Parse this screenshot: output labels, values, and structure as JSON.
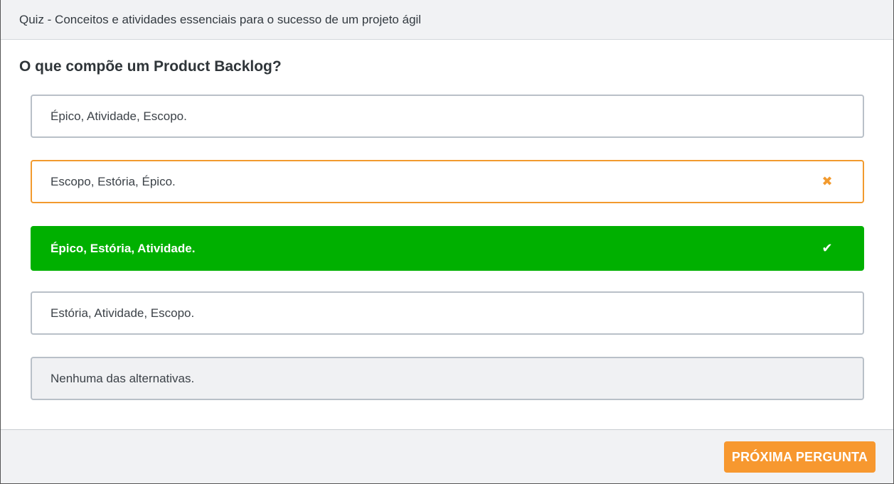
{
  "header": {
    "title": "Quiz - Conceitos e atividades essenciais para o sucesso de um projeto ágil"
  },
  "question": {
    "text": "O que compõe um Product Backlog?"
  },
  "options": [
    {
      "label": "Épico, Atividade, Escopo.",
      "state": "neutral",
      "mark": ""
    },
    {
      "label": "Escopo, Estória, Épico.",
      "state": "wrong",
      "mark": "✖",
      "mark_icon": "x-icon"
    },
    {
      "label": "Épico, Estória, Atividade.",
      "state": "correct",
      "mark": "✔",
      "mark_icon": "check-icon"
    },
    {
      "label": "Estória, Atividade, Escopo.",
      "state": "neutral",
      "mark": ""
    },
    {
      "label": "Nenhuma das alternativas.",
      "state": "disabled",
      "mark": ""
    }
  ],
  "footer": {
    "next_label": "PRÓXIMA PERGUNTA"
  },
  "colors": {
    "correct": "#00b000",
    "wrong": "#f29a2e",
    "primary_button": "#f7982f"
  }
}
